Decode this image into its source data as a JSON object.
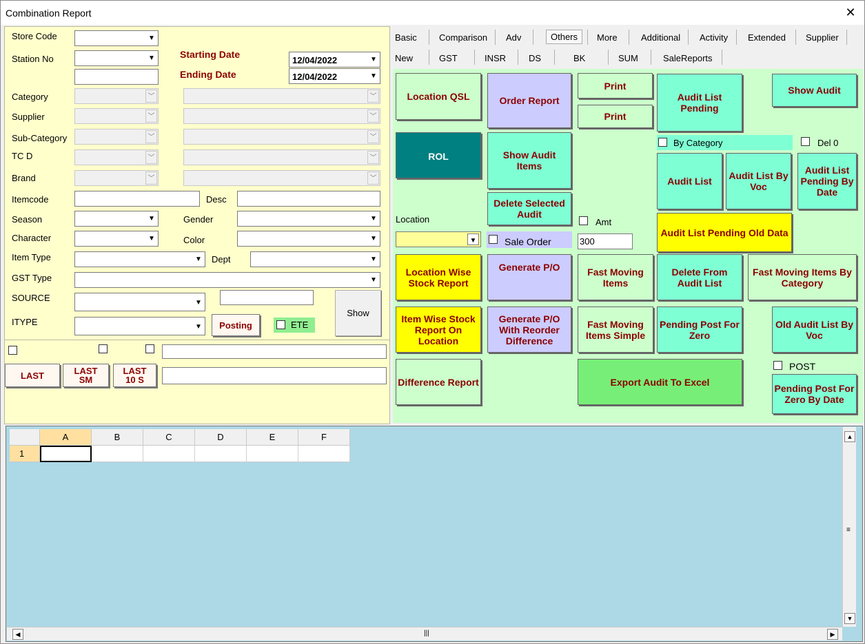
{
  "window": {
    "title": "Combination Report",
    "close_glyph": "✕"
  },
  "left": {
    "store_code_label": "Store Code",
    "station_no_label": "Station No",
    "starting_date_label": "Starting Date",
    "ending_date_label": "Ending Date",
    "starting_date_value": "12/04/2022",
    "ending_date_value": "12/04/2022",
    "category_label": "Category",
    "supplier_label": "Supplier",
    "sub_category_label": "Sub-Category",
    "tcd_label": "TC D",
    "brand_label": "Brand",
    "itemcode_label": "Itemcode",
    "desc_label": "Desc",
    "season_label": "Season",
    "gender_label": "Gender",
    "character_label": "Character",
    "color_label": "Color",
    "item_type_label": "Item Type",
    "dept_label": "Dept",
    "gst_type_label": "GST Type",
    "source_label": "SOURCE",
    "itype_label": "ITYPE",
    "posting_button": "Posting",
    "ete_label": "ETE",
    "show_button": "Show",
    "last_button": "LAST",
    "last_sm_button_line1": "LAST",
    "last_sm_button_line2": "SM",
    "last_10s_button_line1": "LAST",
    "last_10s_button_line2": "10 S"
  },
  "tabs": {
    "row1": [
      "Basic",
      "Comparison",
      "Adv",
      "Others",
      "More",
      "Additional",
      "Activity",
      "Extended",
      "Supplier"
    ],
    "row2": [
      "New",
      "GST",
      "INSR",
      "DS",
      "BK",
      "SUM",
      "SaleReports"
    ],
    "active": "Others"
  },
  "others": {
    "location_qsl": "Location QSL",
    "order_report": "Order Report",
    "print_1": "Print",
    "print_2": "Print",
    "audit_list_pending": "Audit List Pending",
    "show_audit": "Show Audit",
    "rol": "ROL",
    "show_audit_items": "Show Audit Items",
    "by_category": "By Category",
    "del_0": "Del 0",
    "audit_list": "Audit List",
    "audit_list_by_voc": "Audit List By Voc",
    "audit_list_pending_by_date": "Audit List Pending By Date",
    "delete_selected_audit": "Delete Selected Audit",
    "location_label": "Location",
    "amt_label": "Amt",
    "audit_list_pending_old_data": "Audit List Pending Old Data",
    "sale_order_label": "Sale Order",
    "amt_value": "300",
    "location_wise_stock_report": "Location Wise Stock Report",
    "generate_po": "Generate P/O",
    "fast_moving_items": "Fast Moving Items",
    "delete_from_audit_list": "Delete From Audit List",
    "fast_moving_items_by_category": "Fast Moving Items By Category",
    "item_wise_stock_report": "Item Wise Stock Report On Location",
    "generate_po_reorder": "Generate P/O With Reorder Difference",
    "fast_moving_items_simple": "Fast Moving Items Simple",
    "pending_post_for_zero": "Pending Post For Zero",
    "old_audit_list_by_voc": "Old Audit List By Voc",
    "post_label": "POST",
    "difference_report": "Difference Report",
    "export_audit_to_excel": "Export Audit To Excel",
    "pending_post_for_zero_by_date": "Pending Post For Zero By Date"
  },
  "grid": {
    "columns": [
      "A",
      "B",
      "C",
      "D",
      "E",
      "F"
    ],
    "rows": [
      "1"
    ]
  },
  "colors": {
    "left_panel_bg": "#ffffcc",
    "green_area_bg": "#ccffcc",
    "grid_bg": "#add8e6",
    "label_red": "#8b0000"
  }
}
